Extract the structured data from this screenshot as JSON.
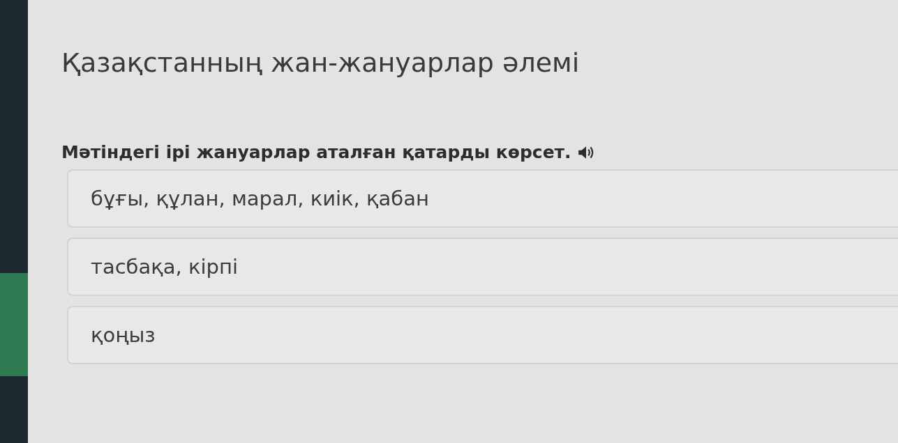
{
  "title": "Қазақстанның жан-жануарлар әлемі",
  "question": {
    "text": "Мәтіндегі ірі жануарлар аталған қатарды көрсет."
  },
  "options": [
    {
      "label": "бұғы, құлан, марал, киік, қабан"
    },
    {
      "label": "тасбақа, кірпі"
    },
    {
      "label": "қоңыз"
    }
  ]
}
